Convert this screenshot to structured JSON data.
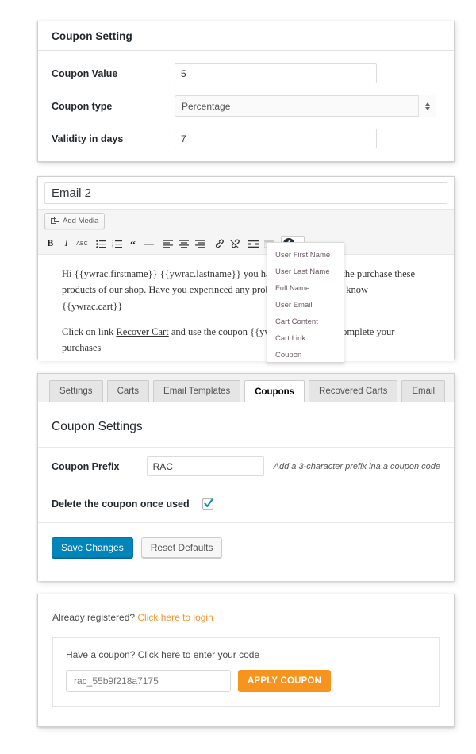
{
  "panel_coupon_setting": {
    "title": "Coupon Setting",
    "fields": [
      {
        "label": "Coupon Value",
        "value": "5",
        "type": "text"
      },
      {
        "label": "Coupon type",
        "value": "Percentage",
        "type": "select"
      },
      {
        "label": "Validity in days",
        "value": "7",
        "type": "text"
      }
    ]
  },
  "panel_email_editor": {
    "title_value": "Email 2",
    "add_media_label": "Add Media",
    "toolbar_buttons": [
      {
        "name": "bold",
        "glyph": "B"
      },
      {
        "name": "italic",
        "glyph": "I"
      },
      {
        "name": "strikethrough",
        "glyph": "ABC"
      },
      {
        "name": "bulleted-list",
        "glyph": ""
      },
      {
        "name": "numbered-list",
        "glyph": ""
      },
      {
        "name": "blockquote",
        "glyph": "“"
      },
      {
        "name": "horizontal-rule",
        "glyph": "—"
      },
      {
        "name": "align-left",
        "glyph": ""
      },
      {
        "name": "align-center",
        "glyph": ""
      },
      {
        "name": "align-right",
        "glyph": ""
      },
      {
        "name": "insert-link",
        "glyph": ""
      },
      {
        "name": "remove-link",
        "glyph": ""
      },
      {
        "name": "insert-read-more",
        "glyph": ""
      },
      {
        "name": "toggle-toolbar",
        "glyph": ""
      }
    ],
    "ywrac_button_label": "ƒ",
    "body_paragraph_1": "Hi {{ywrac.firstname}} {{ywrac.lastname}} you have just left before the purchase these products of our shop. Have you experinced any problem? Please, let us know",
    "body_cart_token": "{{ywrac.cart}}",
    "body_paragraph_2_pre": "Click on link ",
    "body_paragraph_2_link": "Recover Cart",
    "body_paragraph_2_post": " and use the coupon {{ywrac.coupon}} to complete your purchases",
    "dropdown_items": [
      "User First Name",
      "User Last Name",
      "Full Name",
      "User Email",
      "Cart Content",
      "Cart Link",
      "Coupon"
    ]
  },
  "panel_tabs": {
    "tabs": [
      {
        "label": "Settings",
        "active": false
      },
      {
        "label": "Carts",
        "active": false
      },
      {
        "label": "Email Templates",
        "active": false
      },
      {
        "label": "Coupons",
        "active": true
      },
      {
        "label": "Recovered Carts",
        "active": false
      },
      {
        "label": "Email",
        "active": false
      }
    ],
    "section_title": "Coupon Settings",
    "prefix_label": "Coupon Prefix",
    "prefix_value": "RAC",
    "prefix_hint": "Add a 3-character prefix ina a coupon code",
    "delete_label": "Delete the coupon once used",
    "delete_checked": true,
    "save_label": "Save Changes",
    "reset_label": "Reset Defaults"
  },
  "panel_checkout": {
    "registered_text": "Already registered? ",
    "registered_link": "Click here to login",
    "coupon_text": "Have a coupon? ",
    "coupon_link": "Click here to enter your code",
    "coupon_code_value": "rac_55b9f218a7175",
    "apply_label": "APPLY COUPON"
  },
  "colors": {
    "accent_blue": "#0085ba",
    "accent_orange": "#f7941d",
    "link_orange": "#f0962f",
    "panel_border": "#cfcfcf"
  }
}
